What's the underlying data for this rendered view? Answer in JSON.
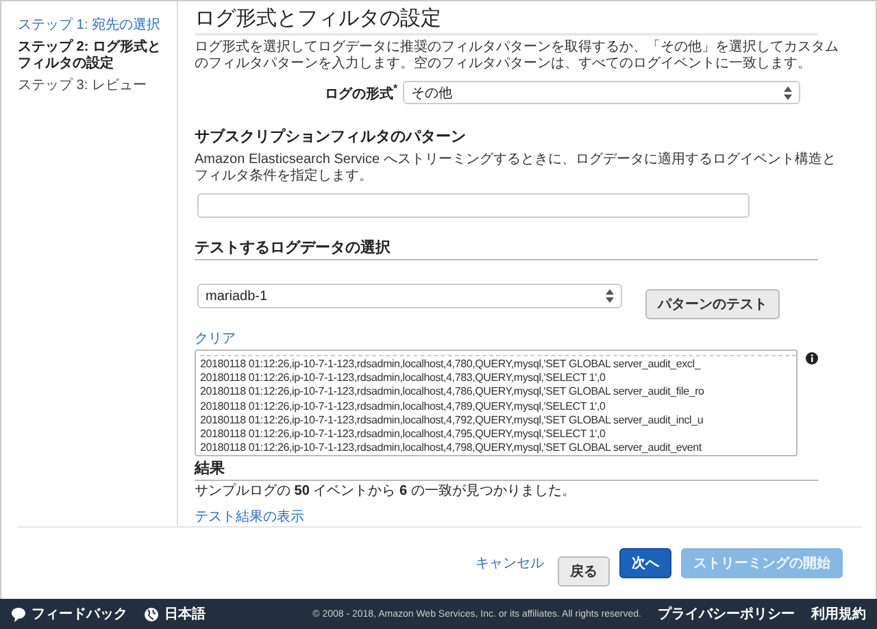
{
  "sidebar": {
    "steps": [
      {
        "label": "ステップ 1: 宛先の選択",
        "selected": false,
        "kind": "link"
      },
      {
        "label": "ステップ 2: ログ形式とフィルタの設定",
        "selected": true,
        "kind": "plain"
      },
      {
        "label": "ステップ 3: レビュー",
        "selected": false,
        "kind": "plain"
      }
    ]
  },
  "main": {
    "title": "ログ形式とフィルタの設定",
    "description": "ログ形式を選択してログデータに推奨のフィルタパターンを取得するか、「その他」を選択してカスタムのフィルタパターンを入力します。空のフィルタパターンは、すべてのログイベントに一致します。",
    "log_format": {
      "label": "ログの形式",
      "required_mark": "*",
      "value": "その他"
    },
    "pattern_section": {
      "title": "サブスクリプションフィルタのパターン",
      "description": "Amazon Elasticsearch Service へストリーミングするときに、ログデータに適用するログイベント構造とフィルタ条件を指定します。"
    },
    "test_section": {
      "title": "テストするログデータの選択",
      "log_source": {
        "value": "mariadb-1"
      },
      "test_button": "パターンのテスト",
      "clear_link": "クリア",
      "log_lines": [
        "20180118 01:12:26,ip-10-7-1-123,rdsadmin,localhost,4,780,QUERY,mysql,'SET GLOBAL server_audit_excl_",
        "20180118 01:12:26,ip-10-7-1-123,rdsadmin,localhost,4,783,QUERY,mysql,'SELECT 1',0",
        "20180118 01:12:26,ip-10-7-1-123,rdsadmin,localhost,4,786,QUERY,mysql,'SET GLOBAL server_audit_file_ro",
        "20180118 01:12:26,ip-10-7-1-123,rdsadmin,localhost,4,789,QUERY,mysql,'SELECT 1',0",
        "20180118 01:12:26,ip-10-7-1-123,rdsadmin,localhost,4,792,QUERY,mysql,'SET GLOBAL server_audit_incl_u",
        "20180118 01:12:26,ip-10-7-1-123,rdsadmin,localhost,4,795,QUERY,mysql,'SELECT 1',0",
        "20180118 01:12:26,ip-10-7-1-123,rdsadmin,localhost,4,798,QUERY,mysql,'SET GLOBAL server_audit_event"
      ]
    },
    "results": {
      "title": "結果",
      "summary": "サンプルログの **50** イベントから **6** の一致が見つかりました。",
      "show_link": "テスト結果の表示"
    }
  },
  "actions": [
    {
      "label": "キャンセル",
      "kind": "link",
      "disabled": false
    },
    {
      "label": "戻る",
      "kind": "secondary",
      "disabled": false
    },
    {
      "label": "次へ",
      "kind": "primary",
      "disabled": false
    },
    {
      "label": "ストリーミングの開始",
      "kind": "primary",
      "disabled": true
    }
  ],
  "footer": {
    "feedback": "フィードバック",
    "language": "日本語",
    "copyright": "© 2008 - 2018, Amazon Web Services, Inc. or its affiliates. All rights reserved.",
    "links": [
      "プライバシーポリシー",
      "利用規約"
    ]
  }
}
